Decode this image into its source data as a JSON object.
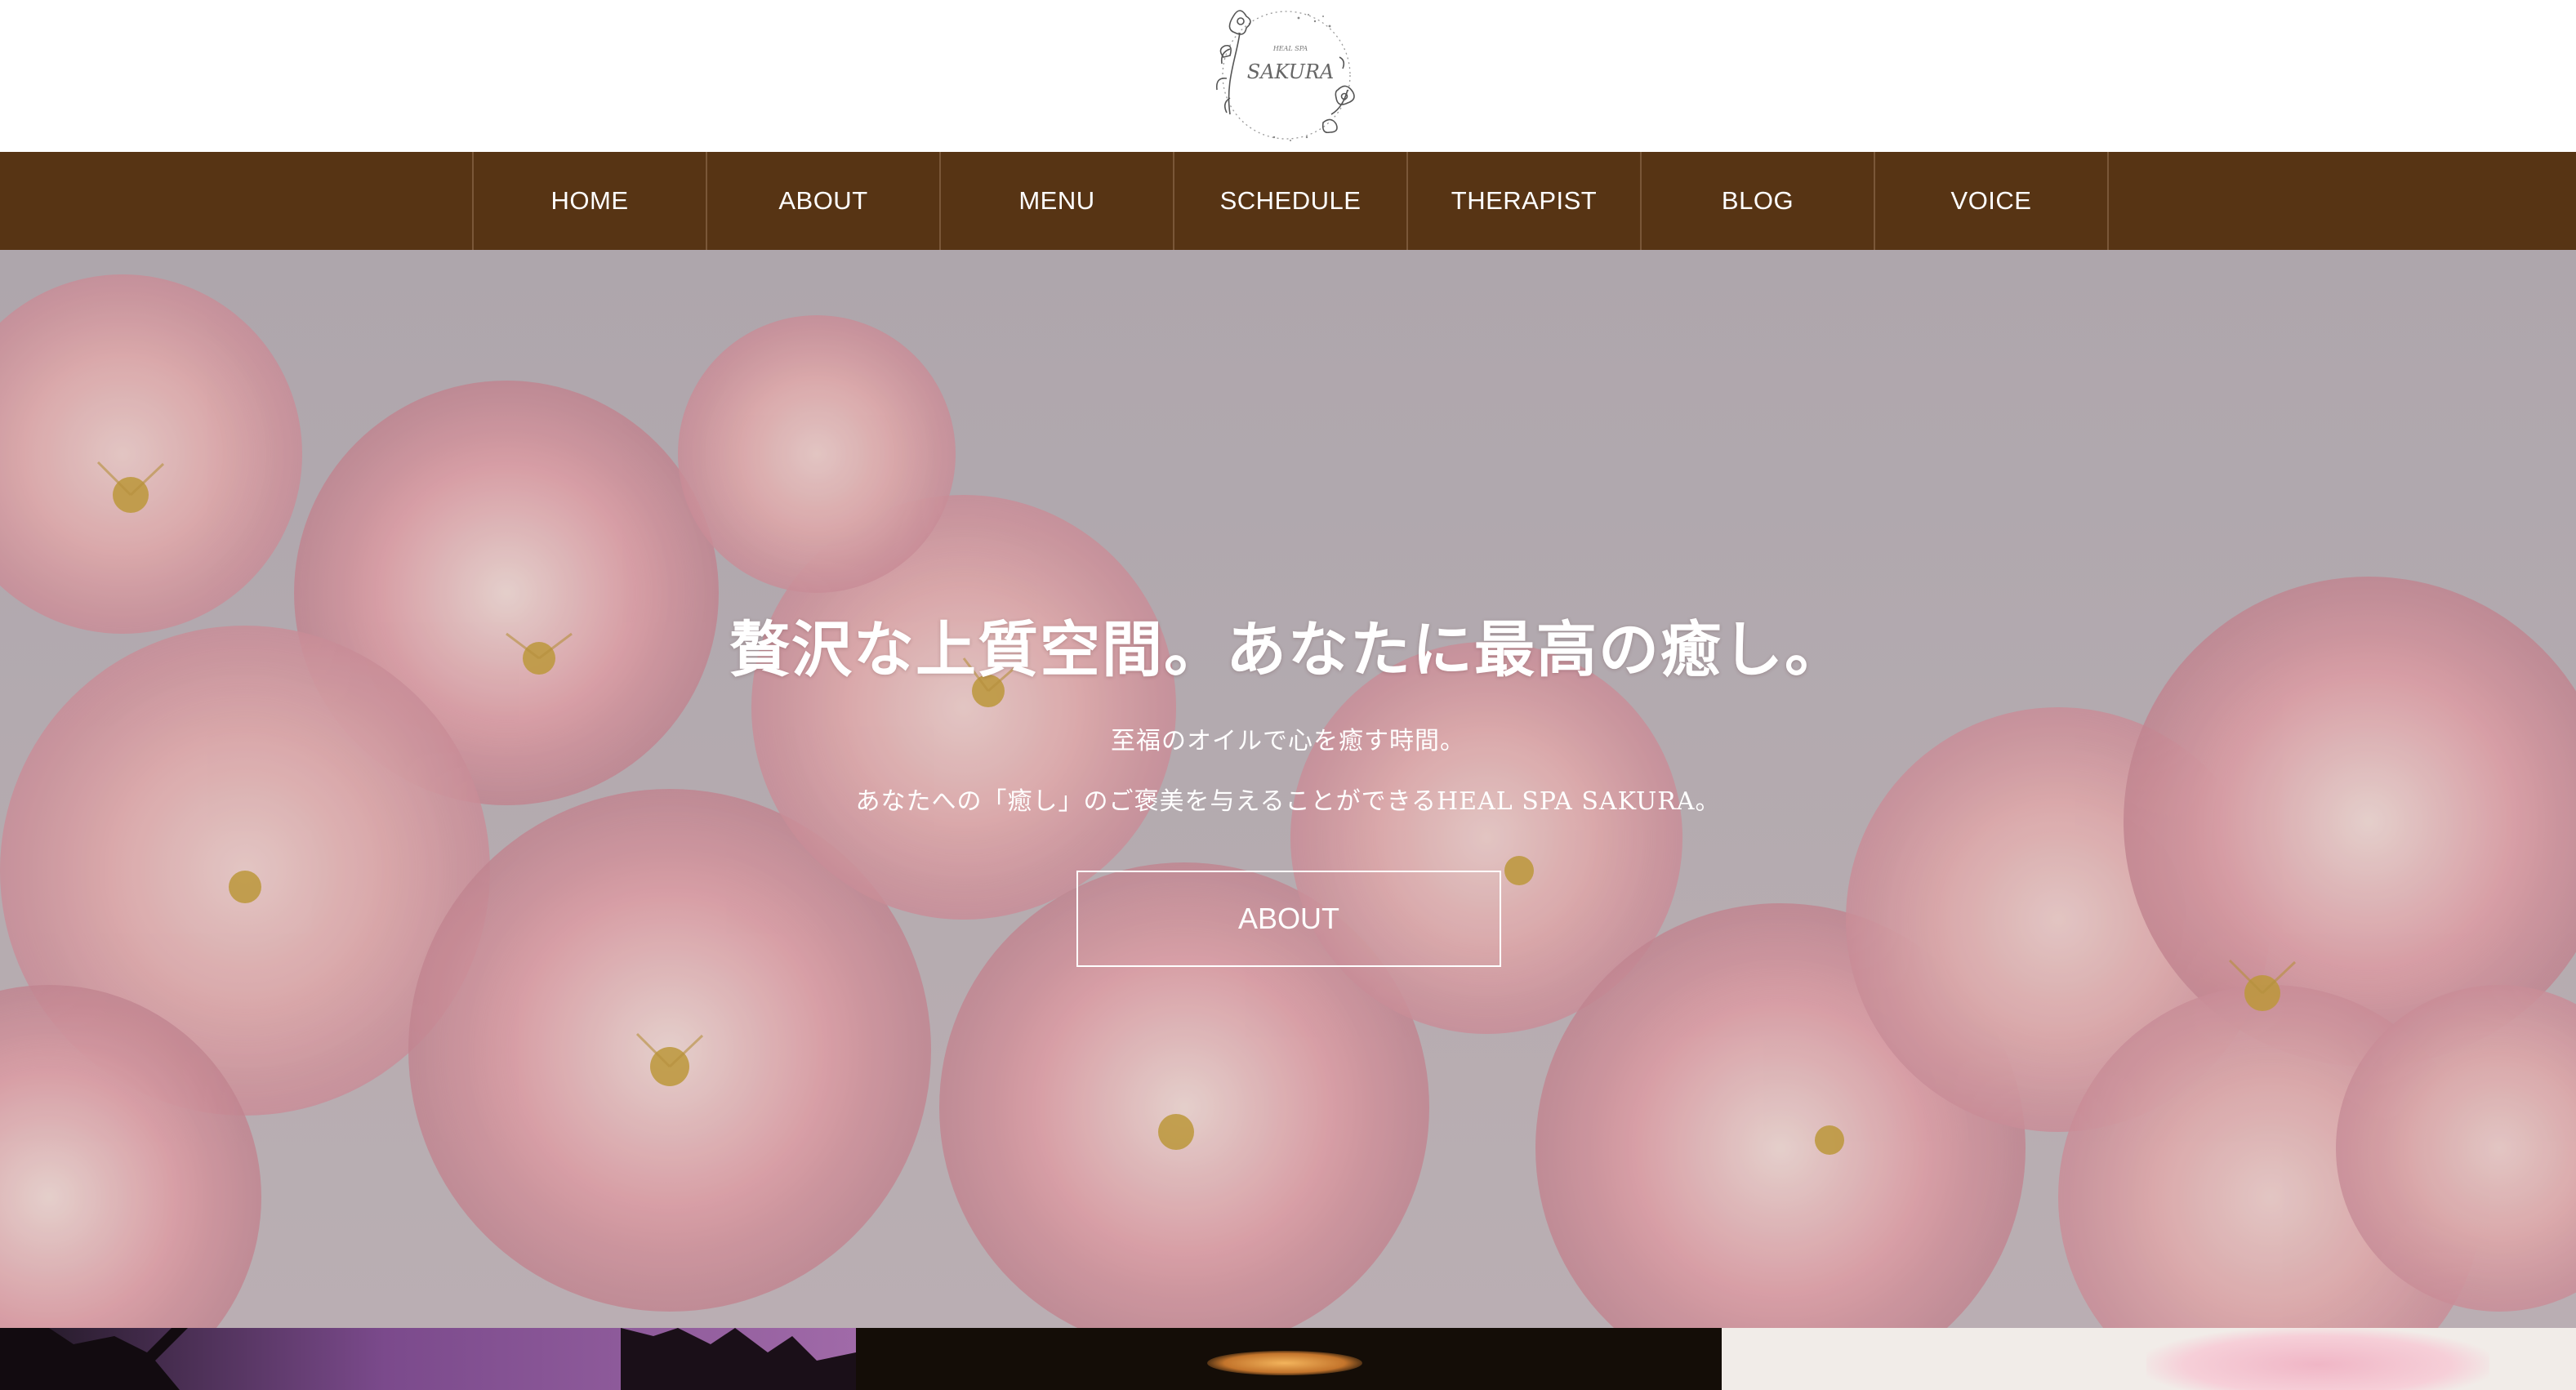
{
  "logo": {
    "line1": "HEAL SPA",
    "line2": "SAKURA"
  },
  "nav": {
    "items": [
      {
        "label": "HOME"
      },
      {
        "label": "ABOUT"
      },
      {
        "label": "MENU"
      },
      {
        "label": "SCHEDULE"
      },
      {
        "label": "THERAPIST"
      },
      {
        "label": "BLOG"
      },
      {
        "label": "VOICE"
      }
    ]
  },
  "hero": {
    "title": "贅沢な上質空間。あなたに最高の癒し。",
    "sub1": "至福のオイルで心を癒す時間。",
    "sub2": "あなたへの「癒し」のご褒美を与えることができるHEAL SPA SAKURA。",
    "button_label": "ABOUT"
  },
  "colors": {
    "nav_bg": "#573414",
    "header_bg": "#ffffff",
    "hero_text": "#ffffff"
  }
}
